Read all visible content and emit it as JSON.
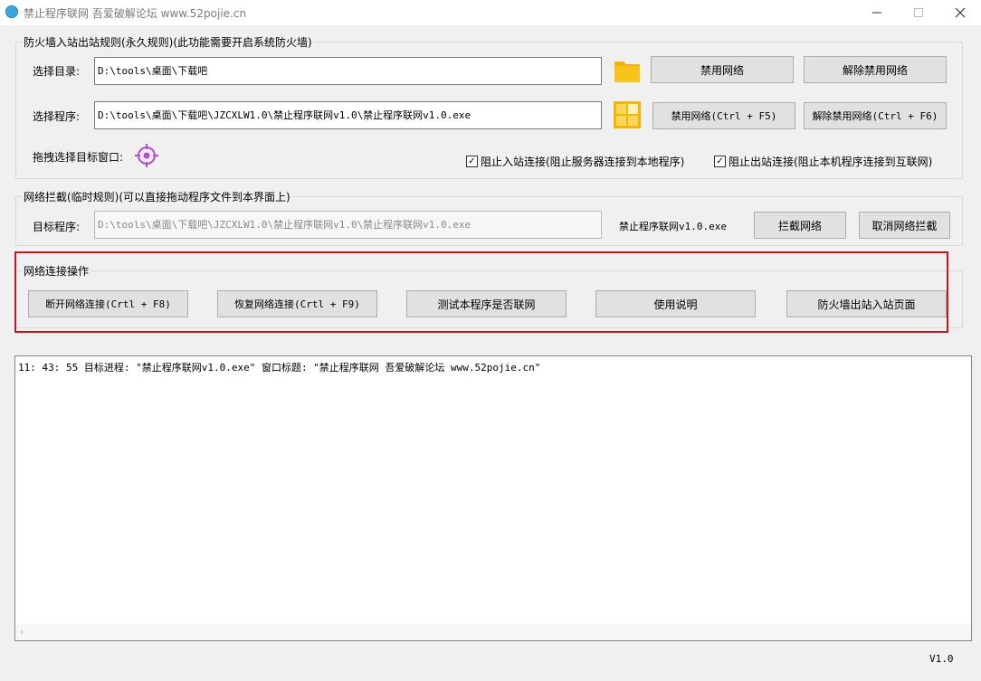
{
  "window": {
    "title": "禁止程序联网 吾爱破解论坛 www.52pojie.cn",
    "minimize_icon": "minimize-icon",
    "maximize_icon": "maximize-icon",
    "close_icon": "close-icon"
  },
  "firewall_group": {
    "title": "防火墙入站出站规则(永久规则)(此功能需要开启系统防火墙)",
    "dir_label": "选择目录:",
    "dir_value": "D:\\tools\\桌面\\下载吧",
    "dir_disable_button": "禁用网络",
    "dir_enable_button": "解除禁用网络",
    "prog_label": "选择程序:",
    "prog_value": "D:\\tools\\桌面\\下载吧\\JZCXLW1.0\\禁止程序联网v1.0\\禁止程序联网v1.0.exe",
    "prog_disable_button": "禁用网络(Ctrl + F5)",
    "prog_enable_button": "解除禁用网络(Ctrl + F6)",
    "drag_label": "拖拽选择目标窗口:",
    "block_inbound": {
      "label": "阻止入站连接(阻止服务器连接到本地程序)",
      "checked": true
    },
    "block_outbound": {
      "label": "阻止出站连接(阻止本机程序连接到互联网)",
      "checked": true
    }
  },
  "intercept_group": {
    "title": "网络拦截(临时规则)(可以直接拖动程序文件到本界面上)",
    "target_label": "目标程序:",
    "target_value": "D:\\tools\\桌面\\下载吧\\JZCXLW1.0\\禁止程序联网v1.0\\禁止程序联网v1.0.exe",
    "target_name": "禁止程序联网v1.0.exe",
    "intercept_button": "拦截网络",
    "cancel_button": "取消网络拦截"
  },
  "network_ops_group": {
    "title": "网络连接操作",
    "disconnect_button": "断开网络连接(Crtl + F8)",
    "restore_button": "恢复网络连接(Crtl + F9)",
    "test_button": "测试本程序是否联网",
    "help_button": "使用说明",
    "firewall_page_button": "防火墙出站入站页面"
  },
  "log": {
    "line1": "11: 43: 55 目标进程: \"禁止程序联网v1.0.exe\" 窗口标题: \"禁止程序联网 吾爱破解论坛 www.52pojie.cn\""
  },
  "version": "V1.0",
  "colors": {
    "highlight": "#c8141e",
    "folder": "#f4b400",
    "target": "#b84dd6"
  }
}
